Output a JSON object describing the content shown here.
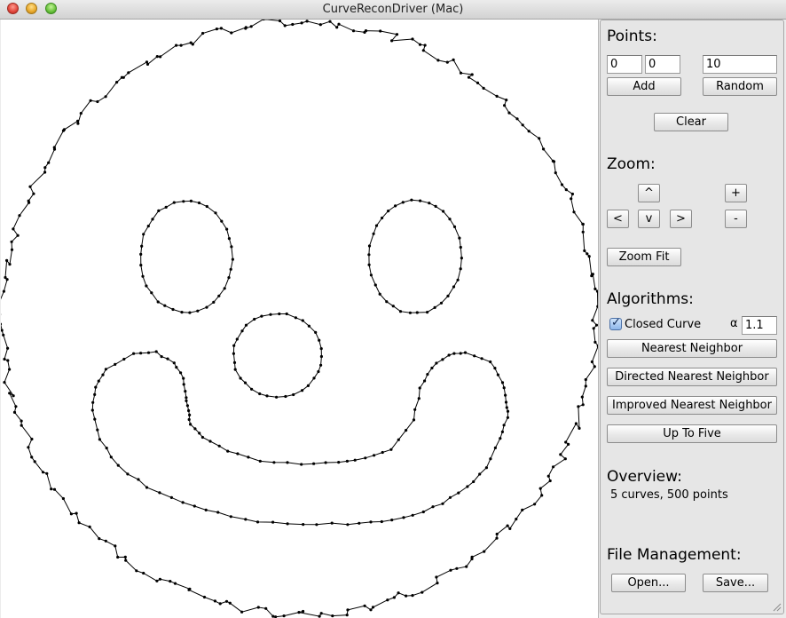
{
  "window": {
    "title": "CurveReconDriver (Mac)"
  },
  "points": {
    "heading": "Points:",
    "x_value": "0",
    "y_value": "0",
    "count_value": "10",
    "add_label": "Add",
    "random_label": "Random",
    "clear_label": "Clear"
  },
  "zoom": {
    "heading": "Zoom:",
    "up_label": "^",
    "left_label": "<",
    "down_label": "v",
    "right_label": ">",
    "plus_label": "+",
    "minus_label": "-",
    "fit_label": "Zoom Fit"
  },
  "algorithms": {
    "heading": "Algorithms:",
    "closed_curve_label": "Closed Curve",
    "closed_curve_checked": true,
    "alpha_symbol": "α",
    "alpha_value": "1.1",
    "buttons": [
      "Nearest Neighbor",
      "Directed Nearest Neighbor",
      "Improved Nearest Neighbor",
      "Up To Five"
    ]
  },
  "overview": {
    "heading": "Overview:",
    "summary": "5 curves, 500 points"
  },
  "file": {
    "heading": "File Management:",
    "open_label": "Open...",
    "save_label": "Save..."
  }
}
